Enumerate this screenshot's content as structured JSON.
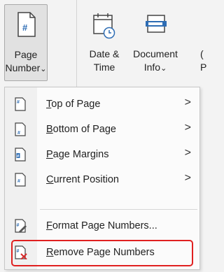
{
  "ribbon": {
    "page_number": {
      "line1": "Page",
      "line2": "Number",
      "chevron": "⌄",
      "icon": "page-number-icon"
    },
    "date_time": {
      "line1": "Date &",
      "line2": "Time",
      "icon": "calendar-clock-icon"
    },
    "document_info": {
      "line1": "Document",
      "line2": "Info",
      "chevron": "⌄",
      "icon": "document-info-icon"
    },
    "partial_label": {
      "line1": "(",
      "line2": "P"
    }
  },
  "menu": {
    "items": [
      {
        "access_key": "T",
        "rest": "op of Page",
        "submenu": true,
        "icon": "top-of-page-icon"
      },
      {
        "access_key": "B",
        "rest": "ottom of Page",
        "submenu": true,
        "icon": "bottom-of-page-icon"
      },
      {
        "access_key": "P",
        "rest": "age Margins",
        "submenu": true,
        "icon": "page-margins-icon"
      },
      {
        "access_key": "C",
        "rest": "urrent Position",
        "submenu": true,
        "icon": "current-position-icon"
      },
      {
        "access_key": "F",
        "rest": "ormat Page Numbers...",
        "submenu": false,
        "icon": "format-page-numbers-icon"
      },
      {
        "access_key": "R",
        "rest": "emove Page Numbers",
        "submenu": false,
        "icon": "remove-page-numbers-icon"
      }
    ],
    "arrow_glyph": ">"
  },
  "colors": {
    "accent": "#2e6db4",
    "highlight_border": "#e02020",
    "remove_x": "#d62b2b"
  }
}
